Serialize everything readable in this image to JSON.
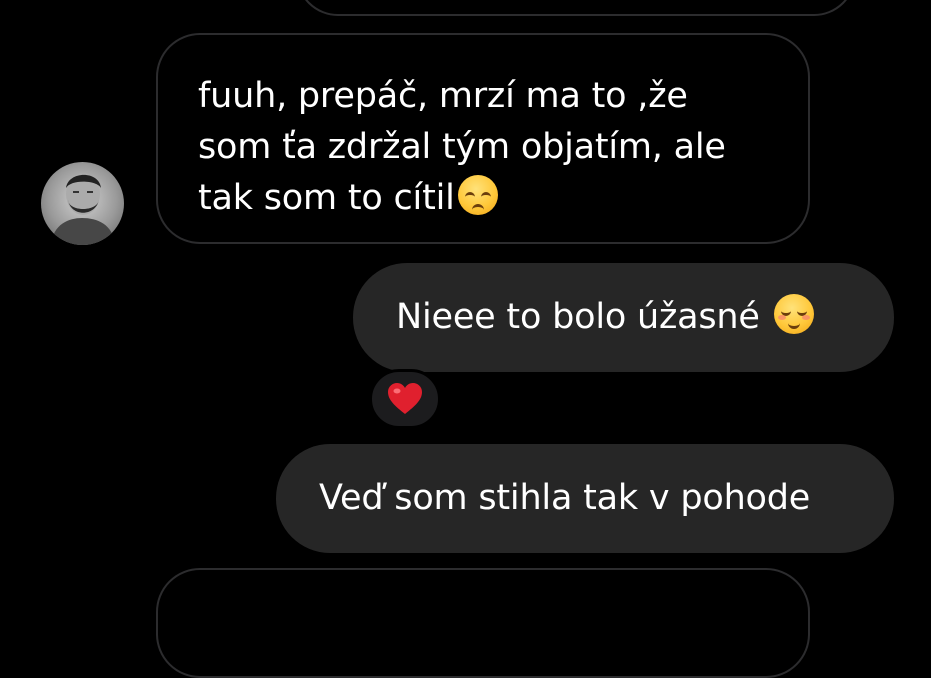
{
  "conversation": {
    "messages": [
      {
        "direction": "received",
        "lines": [
          "fuuh, prepáč, mrzí ma to ,že",
          "som ťa zdržal tým objatím, ale",
          "tak som to cítil"
        ],
        "trailing_emoji": "pensive-face"
      },
      {
        "direction": "sent",
        "text": "Nieee to bolo úžasné",
        "trailing_emoji": "smiling-face",
        "reaction": "red-heart"
      },
      {
        "direction": "sent",
        "text": "Veď som stihla tak v pohode"
      }
    ]
  },
  "colors": {
    "background": "#000000",
    "received_border": "#2c2c2e",
    "sent_bubble": "#262626",
    "text": "#ffffff",
    "heart": "#e0202e"
  }
}
